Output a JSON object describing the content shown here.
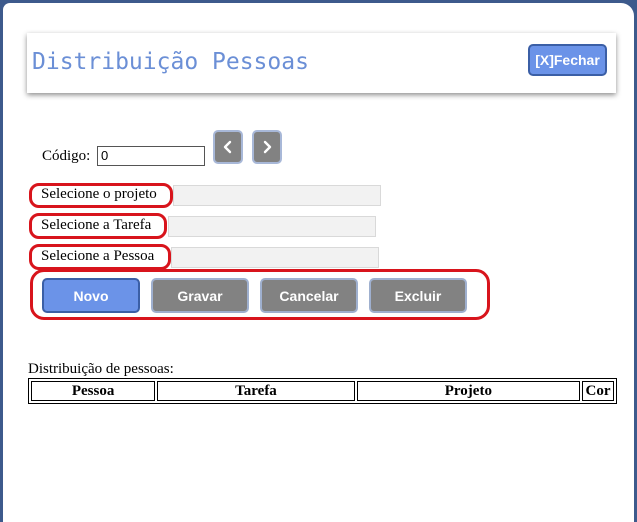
{
  "header": {
    "title": "Distribuição Pessoas",
    "close_label": "[X]Fechar"
  },
  "form": {
    "codigo_label": "Código:",
    "codigo_value": "0",
    "projeto_label": "Selecione o projeto",
    "tarefa_label": "Selecione a Tarefa",
    "pessoa_label": "Selecione a Pessoa"
  },
  "nav": {
    "prev_icon": "chevron-left-icon",
    "next_icon": "chevron-right-icon"
  },
  "actions": {
    "novo": "Novo",
    "gravar": "Gravar",
    "cancelar": "Cancelar",
    "excluir": "Excluir"
  },
  "table": {
    "caption": "Distribuição de pessoas:",
    "columns": [
      "Pessoa",
      "Tarefa",
      "Projeto",
      "Cor"
    ]
  },
  "colors": {
    "primary": "#6b93e8",
    "title": "#6b8fd6",
    "button_gray": "#828282",
    "highlight_ring": "#d8141c",
    "frame_border": "#3d5a8c"
  }
}
